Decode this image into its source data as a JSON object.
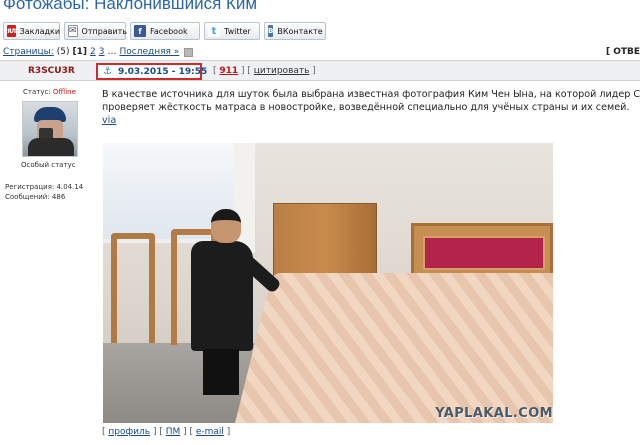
{
  "page": {
    "title": "Фотожабы: Наклонившийся Ким"
  },
  "share_bar": [
    {
      "label": "Закладки",
      "icon": "yandex-bookmarks-icon"
    },
    {
      "label": "Отправить",
      "icon": "mail-icon"
    },
    {
      "label": "Facebook",
      "icon": "facebook-icon"
    },
    {
      "label": "Twitter",
      "icon": "twitter-icon"
    },
    {
      "label": "ВКонтакте",
      "icon": "vkontakte-icon"
    }
  ],
  "pagination": {
    "label": "Страницы:",
    "total": "(5)",
    "current": "[1]",
    "pages": [
      "2",
      "3"
    ],
    "ellipsis": "…",
    "last_label": "Последняя »",
    "go_icon": "go-arrow-icon"
  },
  "reply_label": "[ ОТВЕ",
  "post": {
    "author": "R3SCU3R",
    "datetime": "9.03.2015 - 19:55",
    "anchor_icon": "anchor-icon",
    "number": "911",
    "quote_label": "цитировать",
    "text_lines": [
      "В качестве источника для шуток была выбрана известная фотография Ким Чен Ына, на которой лидер Северн",
      "проверяет жёсткость матраса в новостройке, возведённой специально для учёных страны и их семей."
    ],
    "via_label": "via",
    "photo_watermark": "YAPLAKAL.COM"
  },
  "user": {
    "status_label": "Статус:",
    "status_value": "Offline",
    "special_status": "Особый статус",
    "registration": "Регистрация: 4.04.14",
    "messages": "Сообщений: 486"
  },
  "footer_links": [
    "профиль",
    "ПМ",
    "e-mail"
  ],
  "colors": {
    "link": "#1a4b87",
    "title": "#2a66a8",
    "author": "#8c1a1a",
    "highlight_border": "#d12a2a",
    "offline": "#c31a1a"
  }
}
